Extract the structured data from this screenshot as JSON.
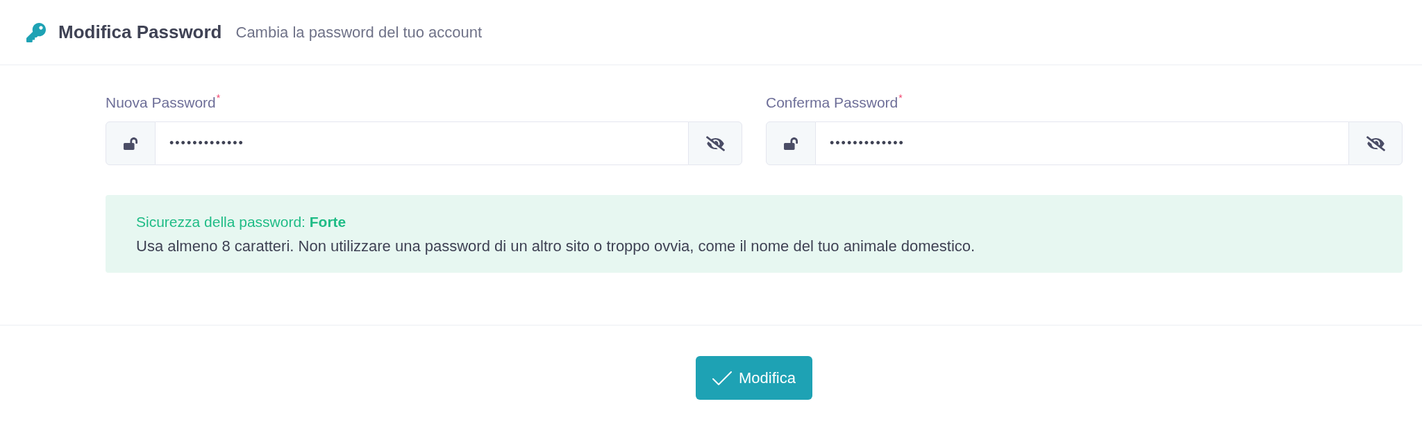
{
  "header": {
    "title": "Modifica Password",
    "subtitle": "Cambia la password del tuo account"
  },
  "fields": [
    {
      "label": "Nuova Password",
      "required_mark": "*",
      "value": "•••••••••••••"
    },
    {
      "label": "Conferma Password",
      "required_mark": "*",
      "value": "•••••••••••••"
    }
  ],
  "strength_alert": {
    "title": "Sicurezza della password: **Forte**",
    "text": "Usa almeno 8 caratteri. Non utilizzare una password di un altro sito o troppo ovvia, come il nome del tuo animale domestico."
  },
  "submit_button": {
    "label": "Modifica"
  }
}
